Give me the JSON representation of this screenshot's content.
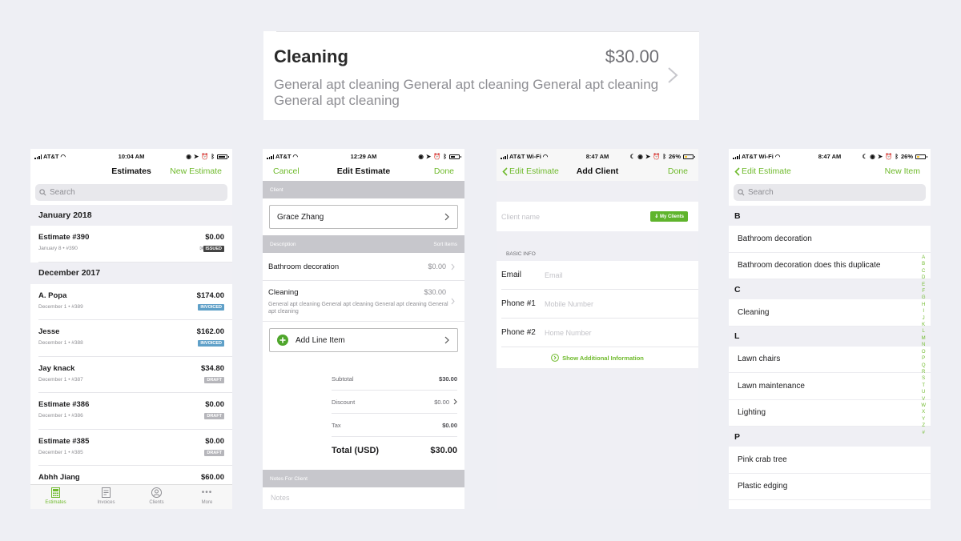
{
  "zoom": {
    "title": "Cleaning",
    "price": "$30.00",
    "description": "General apt cleaning General apt cleaning General apt cleaning General apt cleaning"
  },
  "colors": {
    "accent": "#6fba2c",
    "issued": "#444444",
    "invoiced": "#5fa0c8",
    "draft": "#b6b6bb"
  },
  "screen1": {
    "status": {
      "carrier": "AT&T",
      "time": "10:04 AM"
    },
    "nav": {
      "title": "Estimates",
      "right": "New Estimate"
    },
    "search_placeholder": "Search",
    "sections": [
      {
        "header": "January 2018",
        "rows": [
          {
            "name": "Estimate #390",
            "amount": "$0.00",
            "meta": "January 8  •  #390",
            "badge": "ISSUED"
          }
        ]
      },
      {
        "header": "December 2017",
        "rows": [
          {
            "name": "A. Popa",
            "amount": "$174.00",
            "meta": "December 1  •  #389",
            "badge": "INVOICED"
          },
          {
            "name": "Jesse",
            "amount": "$162.00",
            "meta": "December 1  •  #388",
            "badge": "INVOICED"
          },
          {
            "name": "Jay knack",
            "amount": "$34.80",
            "meta": "December 1  •  #387",
            "badge": "DRAFT"
          },
          {
            "name": "Estimate #386",
            "amount": "$0.00",
            "meta": "December 1  •  #386",
            "badge": "DRAFT"
          },
          {
            "name": "Estimate #385",
            "amount": "$0.00",
            "meta": "December 1  •  #385",
            "badge": "DRAFT"
          },
          {
            "name": "Abhh Jiang",
            "amount": "$60.00",
            "meta": "",
            "badge": ""
          }
        ]
      }
    ],
    "tabs": [
      "Estimates",
      "Invoices",
      "Clients",
      "More"
    ]
  },
  "screen2": {
    "status": {
      "carrier": "AT&T",
      "time": "12:29 AM"
    },
    "nav": {
      "left": "Cancel",
      "title": "Edit Estimate",
      "right": "Done"
    },
    "client_header": "Client",
    "client_name": "Grace Zhang",
    "desc_header": "Description",
    "sort_label": "Sort Items",
    "items": [
      {
        "name": "Bathroom decoration",
        "price": "$0.00",
        "description": ""
      },
      {
        "name": "Cleaning",
        "price": "$30.00",
        "description": "General apt cleaning General apt cleaning General apt cleaning General apt cleaning"
      }
    ],
    "add_line_item": "Add Line Item",
    "totals": {
      "subtotal_label": "Subtotal",
      "subtotal": "$30.00",
      "discount_label": "Discount",
      "discount": "$0.00",
      "tax_label": "Tax",
      "tax": "$0.00",
      "total_label": "Total (USD)",
      "total": "$30.00"
    },
    "notes_header": "Notes For Client",
    "notes_placeholder": "Notes"
  },
  "screen3": {
    "status": {
      "carrier": "AT&T Wi-Fi",
      "time": "8:47 AM",
      "battery": "26%"
    },
    "nav": {
      "left": "Edit Estimate",
      "title": "Add Client",
      "right": "Done"
    },
    "client_name_placeholder": "Client name",
    "my_clients_button": "My Clients",
    "basic_info_header": "BASIC INFO",
    "fields": [
      {
        "label": "Email",
        "placeholder": "Email"
      },
      {
        "label": "Phone #1",
        "placeholder": "Mobile Number"
      },
      {
        "label": "Phone #2",
        "placeholder": "Home Number"
      }
    ],
    "show_more": "Show Additional Information"
  },
  "screen4": {
    "status": {
      "carrier": "AT&T Wi-Fi",
      "time": "8:47 AM",
      "battery": "26%"
    },
    "nav": {
      "left": "Edit Estimate",
      "right": "New Item"
    },
    "search_placeholder": "Search",
    "sections": [
      {
        "letter": "B",
        "items": [
          "Bathroom decoration",
          "Bathroom decoration does this duplicate"
        ]
      },
      {
        "letter": "C",
        "items": [
          "Cleaning"
        ]
      },
      {
        "letter": "L",
        "items": [
          "Lawn chairs",
          "Lawn maintenance",
          "Lighting"
        ]
      },
      {
        "letter": "P",
        "items": [
          "Pink crab tree",
          "Plastic edging"
        ]
      }
    ],
    "index": [
      "A",
      "B",
      "C",
      "D",
      "E",
      "F",
      "G",
      "H",
      "I",
      "J",
      "K",
      "L",
      "M",
      "N",
      "O",
      "P",
      "Q",
      "R",
      "S",
      "T",
      "U",
      "V",
      "W",
      "X",
      "Y",
      "Z",
      "#"
    ]
  }
}
